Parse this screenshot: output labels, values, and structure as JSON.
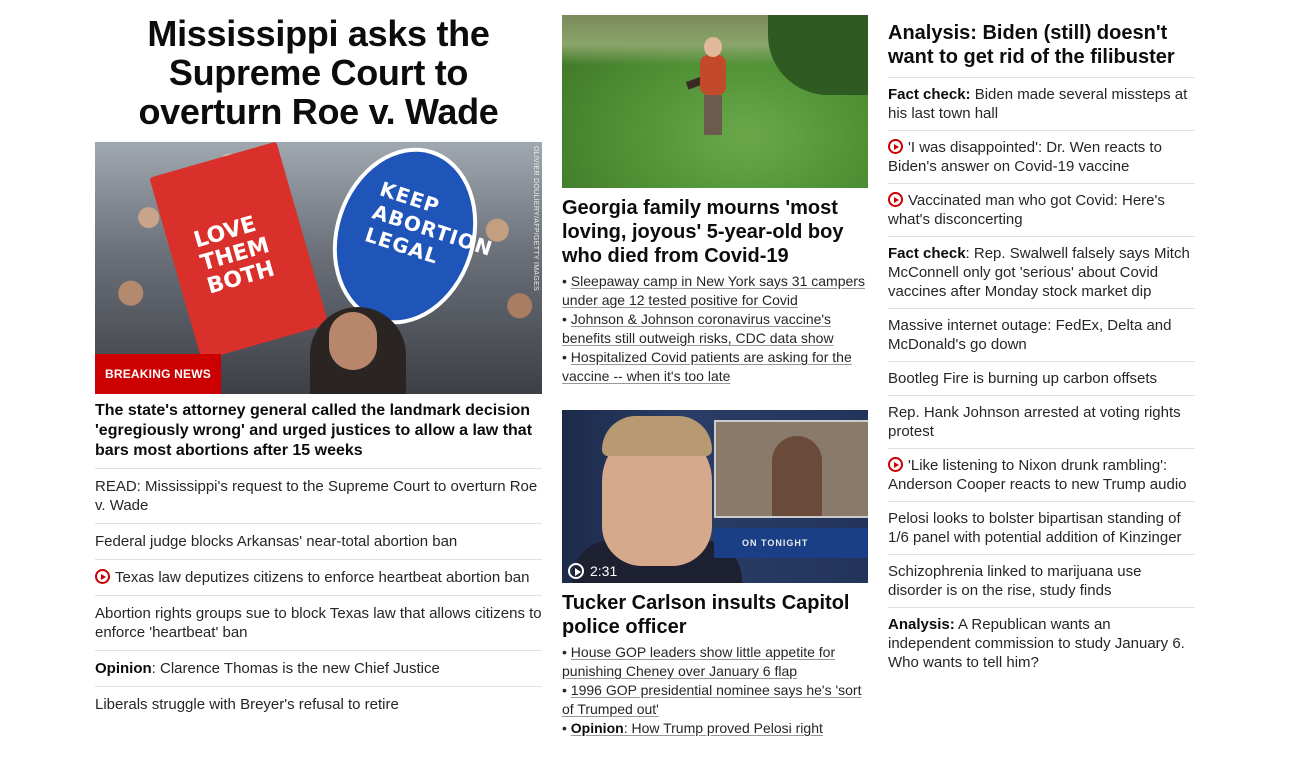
{
  "col1": {
    "title": "Mississippi asks the Supreme Court to overturn Roe v. Wade",
    "hero_sign_left": "LOVE THEM BOTH",
    "hero_sign_right": "KEEP ABORTION LEGAL",
    "hero_credit": "OLIVIER DOULIERY/AFP/GETTY IMAGES",
    "breaking": "BREAKING NEWS",
    "description": "The state's attorney general called the landmark decision 'egregiously wrong' and urged justices to allow a law that bars most abortions after 15 weeks",
    "items": [
      {
        "text": "READ: Mississippi's request to the Supreme Court to overturn Roe v. Wade"
      },
      {
        "text": "Federal judge blocks Arkansas' near-total abortion ban"
      },
      {
        "text": "Texas law deputizes citizens to enforce heartbeat abortion ban"
      },
      {
        "text": "Abortion rights groups sue to block Texas law that allows citizens to enforce 'heartbeat' ban"
      },
      {
        "prefix": "Opinion",
        "text": ": Clarence Thomas is the new Chief Justice"
      },
      {
        "text": "Liberals struggle with Breyer's refusal to retire"
      }
    ]
  },
  "col2": {
    "story1_title": "Georgia family mourns 'most loving, joyous' 5-year-old boy who died from Covid-19",
    "story1_links": [
      "Sleepaway camp in New York says 31 campers under age 12 tested positive for Covid",
      "Johnson & Johnson coronavirus vaccine's benefits still outweigh risks, CDC data show",
      "Hospitalized Covid patients are asking for the vaccine -- when it's too late"
    ],
    "video_duration": "2:31",
    "tucker_banner": "ON TONIGHT",
    "story2_title": "Tucker Carlson insults Capitol police officer",
    "story2_links": [
      {
        "prefix": "",
        "text": "House GOP leaders show little appetite for punishing Cheney over January 6 flap"
      },
      {
        "prefix": "",
        "text": "1996 GOP presidential nominee says he's 'sort of Trumped out'"
      },
      {
        "prefix": "Opinion",
        "text": ": How Trump proved Pelosi right"
      }
    ]
  },
  "col3": {
    "title": "Analysis: Biden (still) doesn't want to get rid of the filibuster",
    "items": [
      {
        "prefix": "Fact check:",
        "text": " Biden made several missteps at his last town hall"
      },
      {
        "text": "'I was disappointed': Dr. Wen reacts to Biden's answer on Covid-19 vaccine"
      },
      {
        "text": "Vaccinated man who got Covid: Here's what's disconcerting"
      },
      {
        "prefix": "Fact check",
        "text": ": Rep. Swalwell falsely says Mitch McConnell only got 'serious' about Covid vaccines after Monday stock market dip"
      },
      {
        "text": "Massive internet outage: FedEx, Delta and McDonald's go down"
      },
      {
        "text": "Bootleg Fire is burning up carbon offsets"
      },
      {
        "text": "Rep. Hank Johnson arrested at voting rights protest"
      },
      {
        "text": "'Like listening to Nixon drunk rambling': Anderson Cooper reacts to new Trump audio"
      },
      {
        "text": "Pelosi looks to bolster bipartisan standing of 1/6 panel with potential addition of Kinzinger"
      },
      {
        "text": "Schizophrenia linked to marijuana use disorder is on the rise, study finds"
      },
      {
        "prefix": "Analysis:",
        "text": " A Republican wants an independent commission to study January 6. Who wants to tell him?"
      }
    ]
  },
  "colors": {
    "breaking_red": "#cc0000",
    "text": "#262626",
    "divider": "#e0e0e0"
  }
}
